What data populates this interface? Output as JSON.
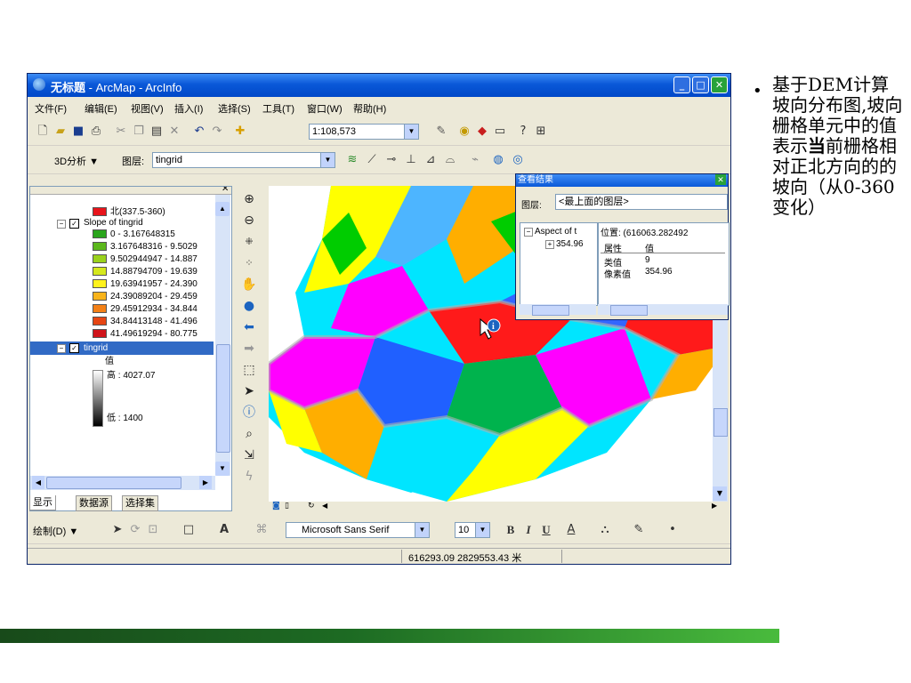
{
  "window": {
    "title_main": "无标题",
    "title_sub": " - ArcMap - ArcInfo"
  },
  "menu": [
    "文件(F)",
    "编辑(E)",
    "视图(V)",
    "插入(I)",
    "选择(S)",
    "工具(T)",
    "窗口(W)",
    "帮助(H)"
  ],
  "toolbar": {
    "scale_value": "1:108,573",
    "analysis_label": "3D分析 ▼",
    "layer_label": "图层:",
    "layer_value": "tingrid"
  },
  "toc": {
    "items": [
      {
        "label": "北(337.5-360)",
        "color": "#e8141b"
      },
      {
        "label": "Slope of tingrid"
      },
      {
        "label": "0 - 3.167648315",
        "color": "#2aa51c"
      },
      {
        "label": "3.167648316 - 9.5029",
        "color": "#5cb81c"
      },
      {
        "label": "9.502944947 - 14.887",
        "color": "#9ad21c"
      },
      {
        "label": "14.88794709 - 19.639",
        "color": "#d5e81d"
      },
      {
        "label": "19.63941957 - 24.390",
        "color": "#fff21c"
      },
      {
        "label": "24.39089204 - 29.459",
        "color": "#f8b31a"
      },
      {
        "label": "29.45912934 - 34.844",
        "color": "#f38016"
      },
      {
        "label": "34.84413148 - 41.496",
        "color": "#e64614"
      },
      {
        "label": "41.49619294 - 80.775",
        "color": "#d0141b"
      },
      {
        "label": "tingrid"
      },
      {
        "label": "值"
      },
      {
        "label": "高 : 4027.07"
      },
      {
        "label": "低 : 1400"
      }
    ],
    "tabs": [
      "显示",
      "数据源",
      "选择集"
    ]
  },
  "popup": {
    "title": "查看结果",
    "layer_label": "图层:",
    "layer_value": "<最上面的图层>",
    "tree_item": "Aspect of t",
    "tree_child": "354.96",
    "position": "位置: (616063.282492",
    "col_attr": "属性",
    "col_val": "值",
    "rows": [
      {
        "attr": "类值",
        "val": "9"
      },
      {
        "attr": "像素值",
        "val": "354.96"
      }
    ]
  },
  "draw_toolbar": {
    "draw_label": "绘制(D) ▼",
    "font_name": "Microsoft Sans Serif",
    "font_size": "10",
    "bold": "B",
    "italic": "I",
    "underline": "U"
  },
  "status": {
    "coords": "616293.09  2829553.43 米"
  },
  "slide": {
    "bullet_text": "基于DEM计算坡向分布图,坡向栅格单元中的值表示",
    "bullet_bold": "当",
    "bullet_text2": "前栅格相对正北方向的的坡向（从0-360变化）"
  },
  "colors": {
    "title_blue": "#0a58d8",
    "footer_green": "#2e8b2f"
  }
}
